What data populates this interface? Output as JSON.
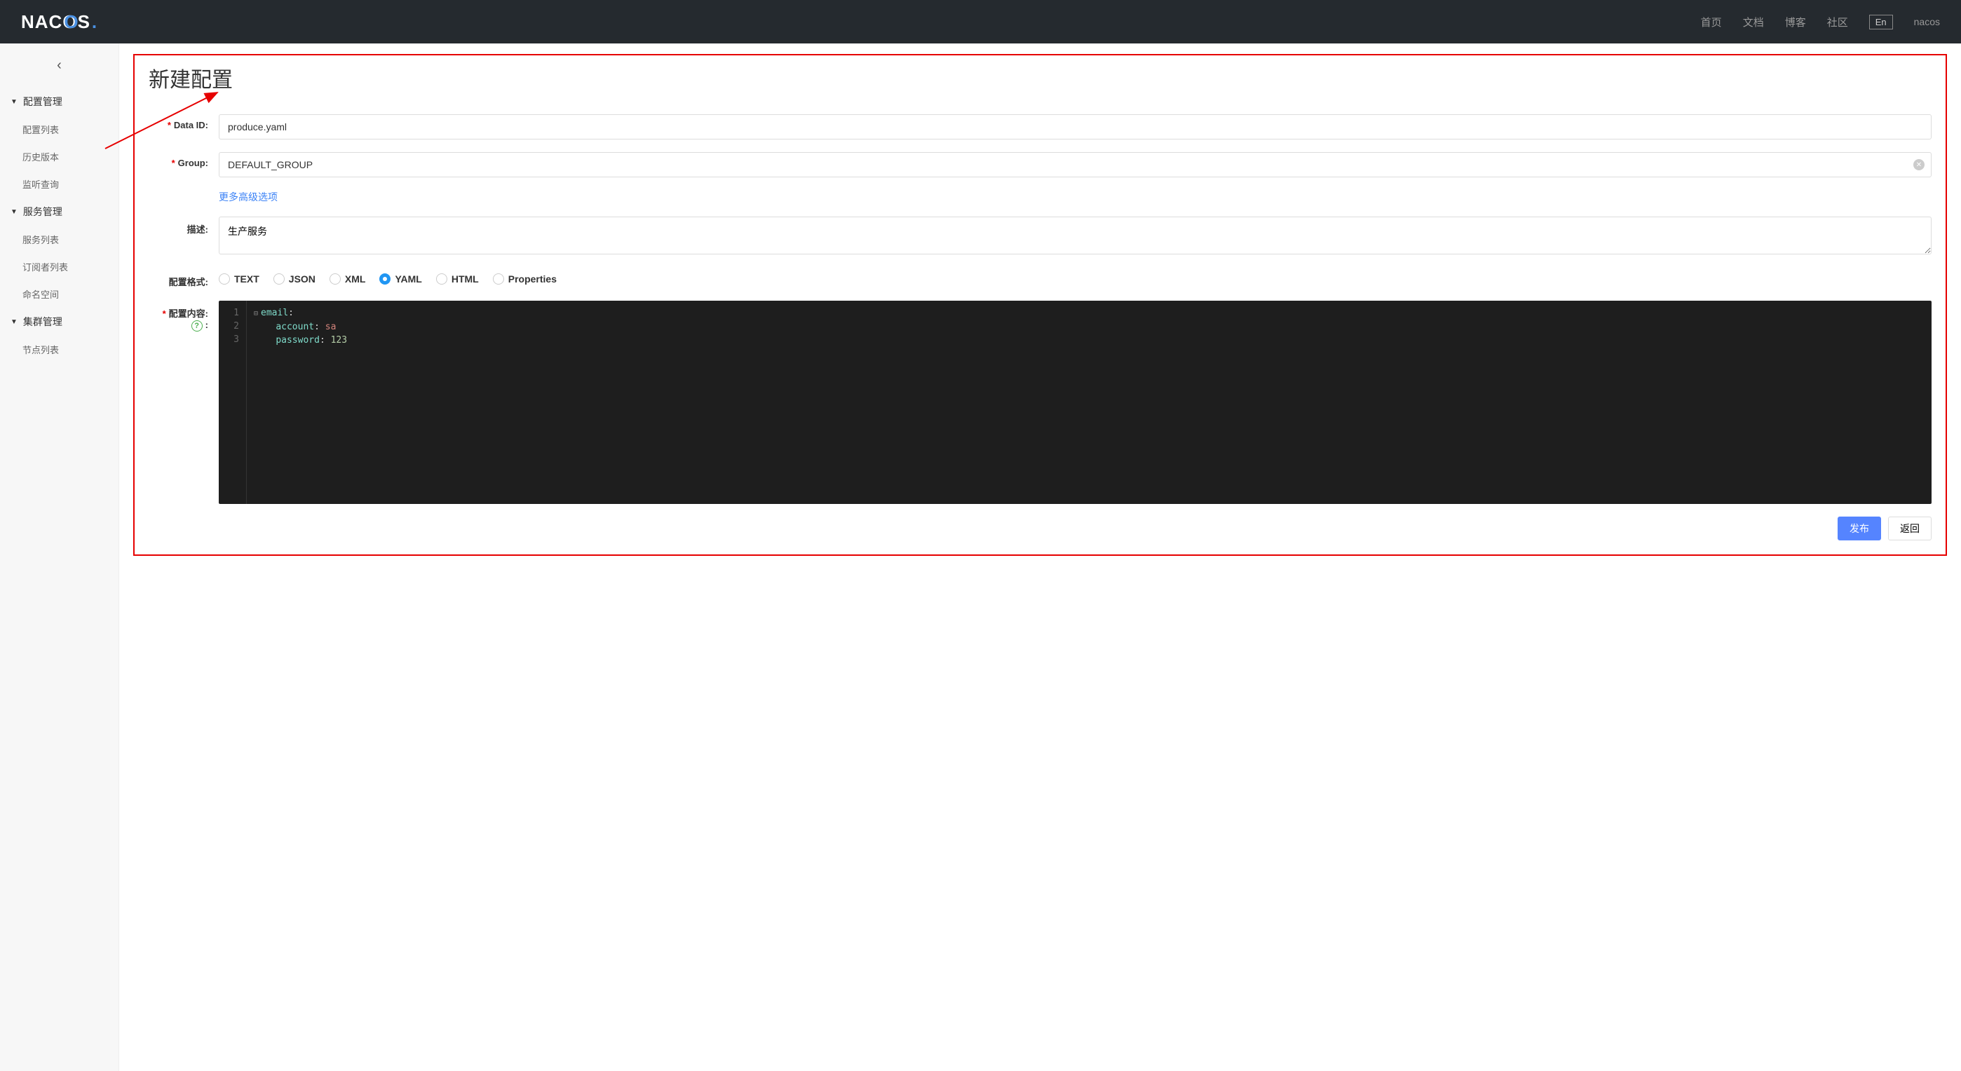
{
  "header": {
    "logo_part1": "NAC",
    "logo_part2": "OS",
    "nav": [
      "首页",
      "文档",
      "博客",
      "社区"
    ],
    "lang": "En",
    "user": "nacos"
  },
  "sidebar": {
    "groups": [
      {
        "label": "配置管理",
        "items": [
          "配置列表",
          "历史版本",
          "监听查询"
        ]
      },
      {
        "label": "服务管理",
        "items": [
          "服务列表",
          "订阅者列表"
        ]
      }
    ],
    "standalone": "命名空间",
    "group3": {
      "label": "集群管理",
      "items": [
        "节点列表"
      ]
    }
  },
  "page": {
    "title": "新建配置",
    "labels": {
      "dataId": "Data ID:",
      "group": "Group:",
      "advanced": "更多高级选项",
      "desc": "描述:",
      "format": "配置格式:",
      "content": "配置内容:"
    },
    "values": {
      "dataId": "produce.yaml",
      "group": "DEFAULT_GROUP",
      "desc": "生产服务"
    },
    "formats": [
      "TEXT",
      "JSON",
      "XML",
      "YAML",
      "HTML",
      "Properties"
    ],
    "selectedFormat": "YAML",
    "code": {
      "lines": [
        "1",
        "2",
        "3"
      ],
      "l1_key": "email",
      "l2_key": "account",
      "l2_val": "sa",
      "l3_key": "password",
      "l3_val": "123"
    },
    "buttons": {
      "publish": "发布",
      "back": "返回"
    }
  }
}
